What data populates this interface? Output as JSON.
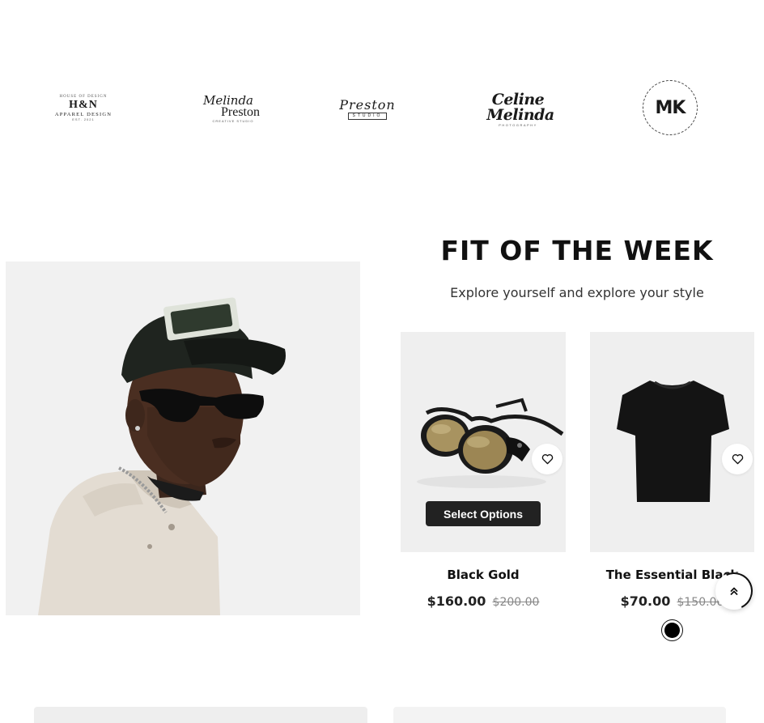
{
  "brands": {
    "hn": {
      "arc": "HOUSE OF DESIGN",
      "main": "H&N",
      "sub": "APPAREL DESIGN",
      "tiny": "EST. 2021"
    },
    "melinda_preston": {
      "script": "Melinda",
      "main": "Preston",
      "sub": "CREATIVE STUDIO"
    },
    "preston": {
      "script": "Preston",
      "sub": "STUDIO"
    },
    "celine_melinda": {
      "line1": "Celine",
      "line2": "Melinda",
      "sub": "PHOTOGRAPHY"
    },
    "mk": {
      "main": "MK"
    }
  },
  "section": {
    "title": "FIT OF THE WEEK",
    "subtitle": "Explore yourself and explore your style"
  },
  "products": [
    {
      "name": "Black Gold",
      "price": "$160.00",
      "compare_price": "$200.00",
      "action_label": "Select Options",
      "wishlist_icon": "heart-icon"
    },
    {
      "name": "The Essential Black",
      "price": "$70.00",
      "compare_price": "$150.00",
      "swatch_color": "#000000",
      "wishlist_icon": "heart-icon"
    }
  ],
  "scroll_top_icon": "double-chevron-up-icon"
}
